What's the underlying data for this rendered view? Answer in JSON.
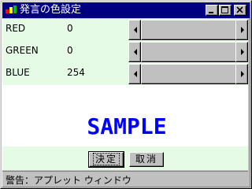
{
  "window": {
    "title": "発言の色設定",
    "icon": "java-applet-icon",
    "controls": [
      "minimize-icon",
      "maximize-icon",
      "close-icon"
    ]
  },
  "colors": [
    {
      "label": "RED",
      "value": "0",
      "level": 0
    },
    {
      "label": "GREEN",
      "value": "0",
      "level": 0
    },
    {
      "label": "BLUE",
      "value": "254",
      "level": 254
    }
  ],
  "scroll_max": 255,
  "sample": {
    "text": "SAMPLE",
    "color": "#0000fe"
  },
  "buttons": {
    "ok": "決定",
    "cancel": "取消"
  },
  "status": "警告：アプレット ウィンドウ"
}
